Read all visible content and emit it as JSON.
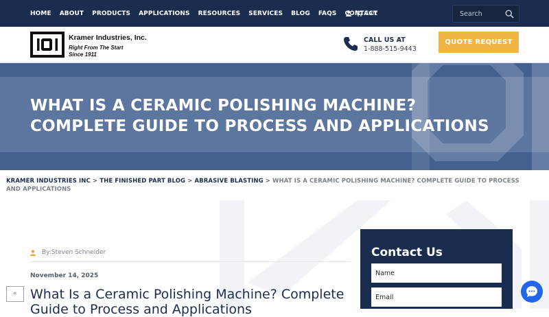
{
  "nav": {
    "items": [
      "HOME",
      "ABOUT",
      "PRODUCTS",
      "APPLICATIONS",
      "RESOURCES",
      "SERVICES",
      "BLOG",
      "FAQS",
      "CONTACT"
    ],
    "cart_label": "Cart",
    "search_placeholder": "Search"
  },
  "header": {
    "company_name": "Kramer Industries, Inc.",
    "tagline": "Right From The Start",
    "since": "Since  1911",
    "call_label": "CALL US AT",
    "phone": "1-888-515-9443",
    "quote_label": "QUOTE REQUEST"
  },
  "hero": {
    "title_line1": "WHAT IS A CERAMIC POLISHING MACHINE?",
    "title_line2": "COMPLETE GUIDE TO PROCESS AND APPLICATIONS"
  },
  "breadcrumb": {
    "items": [
      "KRAMER INDUSTRIES INC",
      "THE FINISHED PART BLOG",
      "ABRASIVE BLASTING"
    ],
    "separator": ">",
    "current": "WHAT IS A CERAMIC POLISHING MACHINE? COMPLETE GUIDE TO PROCESS AND APPLICATIONS"
  },
  "article": {
    "author": "By:Steven Schneider",
    "date": "November 14, 2025",
    "title": "What Is a Ceramic Polishing Machine? Complete Guide to Process and Applications"
  },
  "contact": {
    "heading": "Contact Us",
    "name_placeholder": "Name",
    "email_placeholder": "Email"
  },
  "scroll_up_label": "«",
  "colors": {
    "navy": "#1b2d4f",
    "accent": "#f1b446",
    "chat": "#2167e8"
  }
}
